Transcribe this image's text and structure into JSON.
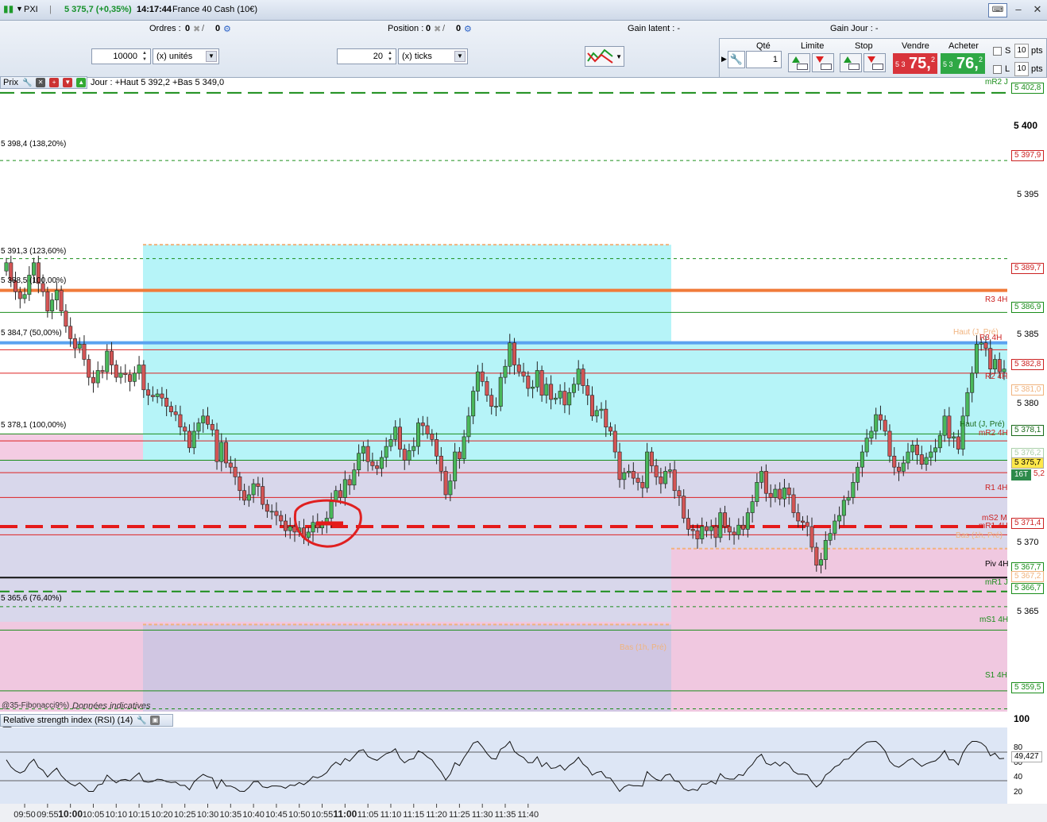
{
  "titlebar": {
    "app": "PXI",
    "price": "5 375,7 (+0,35%)",
    "time": "14:17:44",
    "instrument": "France 40 Cash (10€)"
  },
  "orderbar": {
    "ordres_label": "Ordres :",
    "ordres_val": "0",
    "position_label": "Position :",
    "position_val1": "0",
    "position_val2": "0",
    "ordres_val2": "0",
    "gain_latent": "Gain latent : -",
    "gain_jour": "Gain Jour : -",
    "qty_value": "10000",
    "qty_unit": "(x) unités",
    "ticks_value": "20",
    "ticks_unit": "(x) ticks"
  },
  "trade_panel": {
    "qte_label": "Qté",
    "qte_value": "1",
    "limite_label": "Limite",
    "stop_label": "Stop",
    "vendre_label": "Vendre",
    "acheter_label": "Acheter",
    "sell_small": "5 3",
    "sell_big": "75,",
    "sell_sup": "2",
    "buy_small": "5 3",
    "buy_big": "76,",
    "buy_sup": "2",
    "s_label": "S",
    "l_label": "L",
    "pts1": "10",
    "pts2": "10",
    "pts_unit": "pts",
    "sell_color": "#d8343b",
    "buy_color": "#2fa845"
  },
  "price_panel": {
    "title": "Prix",
    "header_info": "Jour : +Haut 5 392,2 +Bas 5 349,0",
    "footer_note": "Données indicatives",
    "footer_garbled": "@35-Fibonacci9%)"
  },
  "fib_labels": [
    "5 398,4 (138,20%)",
    "5 391,3 (123,60%)",
    "5 388,5 (100,00%)",
    "5 384,7 (50,00%)",
    "5 378,1 (100,00%)",
    "5 365,6 (76,40%)"
  ],
  "right_labels": [
    "mR2 J",
    "R3 4H",
    "R3 4H",
    "R2 4H",
    "Haut (J, Pré)",
    "mR2 4H",
    "R1 4H",
    "mS2 M",
    "mR1 4H",
    "Piv 4H",
    "mR1 J",
    "mS1 4H",
    "S1 4H",
    "Haut (J, Pré)",
    "Bas (1h, Pré)",
    "Bas (1h, Pré)"
  ],
  "axis": {
    "prices": [
      "5 400",
      "5 395",
      "5 385",
      "5 380",
      "5 370",
      "5 365"
    ],
    "tags": [
      "5 402,8",
      "5 397,9",
      "5 389,7",
      "5 386,9",
      "5 382,8",
      "5 381,0",
      "5 378,1",
      "5 376,2",
      "5 375,7",
      "5,2",
      "16T",
      "5 371,4",
      "5 367,7",
      "5 367,2",
      "5 366,7",
      "5 359,5"
    ],
    "times": [
      "09:50",
      "09:55",
      "10:00",
      "10:05",
      "10:10",
      "10:15",
      "10:20",
      "10:25",
      "10:30",
      "10:35",
      "10:40",
      "10:45",
      "10:50",
      "10:55",
      "11:00",
      "11:05",
      "11:10",
      "11:15",
      "11:20",
      "11:25",
      "11:30",
      "11:35",
      "11:40"
    ],
    "rsi_levels": [
      "100",
      "80",
      "60",
      "40",
      "20"
    ],
    "rsi_value": "49,427"
  },
  "rsi_panel": {
    "title": "Relative strength index (RSI) (14)"
  },
  "chart_data": {
    "type": "candlestick",
    "instrument": "France 40 Cash (10€)",
    "interval": "1 minute",
    "x_range": [
      "09:46",
      "11:42"
    ],
    "ylim": [
      5358,
      5404
    ],
    "close": [
      5390.5,
      5389.2,
      5388.4,
      5387.9,
      5388.2,
      5389.6,
      5390.5,
      5389.0,
      5388.4,
      5387.0,
      5387.8,
      5388.5,
      5387.0,
      5385.9,
      5385.0,
      5384.3,
      5384.6,
      5383.5,
      5382.2,
      5381.8,
      5382.7,
      5382.6,
      5384.1,
      5383.1,
      5382.2,
      5382.5,
      5382.4,
      5381.9,
      5382.5,
      5383.1,
      5381.3,
      5380.9,
      5380.8,
      5381.0,
      5380.7,
      5380.1,
      5379.7,
      5379.5,
      5378.6,
      5378.3,
      5377.1,
      5378.3,
      5378.9,
      5379.4,
      5378.8,
      5378.4,
      5376.1,
      5377.5,
      5376.0,
      5375.7,
      5375.0,
      5374.0,
      5373.3,
      5373.7,
      5374.5,
      5374.3,
      5373.0,
      5372.5,
      5372.5,
      5372.2,
      5371.8,
      5371.1,
      5371.4,
      5371.0,
      5371.3,
      5370.6,
      5371.0,
      5371.7,
      5371.3,
      5371.5,
      5372.0,
      5373.2,
      5374.0,
      5373.5,
      5374.8,
      5374.4,
      5375.5,
      5376.7,
      5377.2,
      5376.1,
      5375.8,
      5375.6,
      5376.4,
      5377.2,
      5377.7,
      5378.6,
      5377.0,
      5376.2,
      5376.9,
      5377.2,
      5378.9,
      5378.7,
      5378.1,
      5377.7,
      5376.5,
      5375.4,
      5373.7,
      5374.7,
      5376.8,
      5376.3,
      5377.9,
      5379.4,
      5381.2,
      5382.6,
      5381.9,
      5380.9,
      5380.1,
      5380.1,
      5382.2,
      5383.0,
      5384.7,
      5383.1,
      5382.6,
      5382.3,
      5381.4,
      5381.5,
      5382.7,
      5380.9,
      5381.7,
      5380.6,
      5380.7,
      5381.2,
      5380.2,
      5381.1,
      5381.7,
      5382.8,
      5381.6,
      5380.9,
      5379.4,
      5379.8,
      5379.9,
      5378.6,
      5378.3,
      5376.8,
      5374.8,
      5375.3,
      5375.4,
      5374.9,
      5374.6,
      5374.2,
      5376.8,
      5375.8,
      5375.0,
      5374.5,
      5375.4,
      5375.5,
      5374.0,
      5373.6,
      5372.0,
      5371.2,
      5371.1,
      5370.5,
      5371.4,
      5371.1,
      5371.4,
      5370.6,
      5372.4,
      5371.4,
      5371.0,
      5370.8,
      5371.5,
      5371.2,
      5372.4,
      5373.2,
      5374.6,
      5375.4,
      5373.8,
      5373.5,
      5374.1,
      5373.4,
      5374.2,
      5373.7,
      5372.4,
      5371.8,
      5371.7,
      5371.4,
      5369.9,
      5368.6,
      5369.0,
      5370.4,
      5370.9,
      5371.8,
      5372.2,
      5373.3,
      5373.5,
      5374.6,
      5375.7,
      5376.8,
      5377.8,
      5378.3,
      5379.5,
      5379.1,
      5378.3,
      5376.5,
      5375.7,
      5375.4,
      5376.0,
      5376.8,
      5377.3,
      5376.6,
      5375.9,
      5376.4,
      5376.8,
      5377.1,
      5378.0,
      5379.4,
      5377.8,
      5377.9,
      5377.0,
      5379.4,
      5381.1,
      5382.5,
      5384.6,
      5384.7,
      5384.3,
      5382.8,
      5383.5,
      5382.6,
      5382.8
    ]
  },
  "rsi_data": {
    "ylim": [
      0,
      100
    ],
    "guide_lines": [
      70,
      30
    ],
    "last": 49.427
  }
}
